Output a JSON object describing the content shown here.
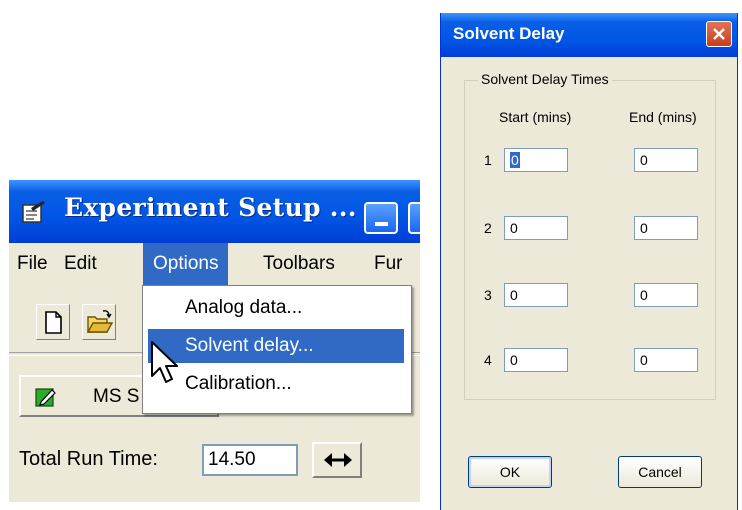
{
  "experiment_window": {
    "title": "Experiment Setup ...",
    "menu": [
      "File",
      "Edit",
      "Options",
      "Toolbars",
      "Fur"
    ],
    "options_dropdown": [
      "Analog data...",
      "Solvent delay...",
      "Calibration..."
    ],
    "ms_button_label": "MS S",
    "total_run_time_label": "Total Run Time:",
    "total_run_time_value": "14.50"
  },
  "solvent_dialog": {
    "title": "Solvent Delay",
    "group_label": "Solvent Delay Times",
    "start_header": "Start (mins)",
    "end_header": "End (mins)",
    "rows": [
      {
        "num": "1",
        "start": "0",
        "end": "0"
      },
      {
        "num": "2",
        "start": "0",
        "end": "0"
      },
      {
        "num": "3",
        "start": "0",
        "end": "0"
      },
      {
        "num": "4",
        "start": "0",
        "end": "0"
      }
    ],
    "ok_label": "OK",
    "cancel_label": "Cancel"
  },
  "icons": {
    "title_icon": "checklist-icon",
    "new": "new-document-icon",
    "open": "open-folder-icon",
    "ms_icon": "edit-pencil-icon",
    "expand": "double-arrow-icon",
    "close": "close-icon",
    "cursor": "mouse-pointer-icon"
  },
  "colors": {
    "titlebar": "#0055e5",
    "highlight": "#316ac5",
    "window_bg": "#ece9d8",
    "close_button": "#c2401e"
  }
}
